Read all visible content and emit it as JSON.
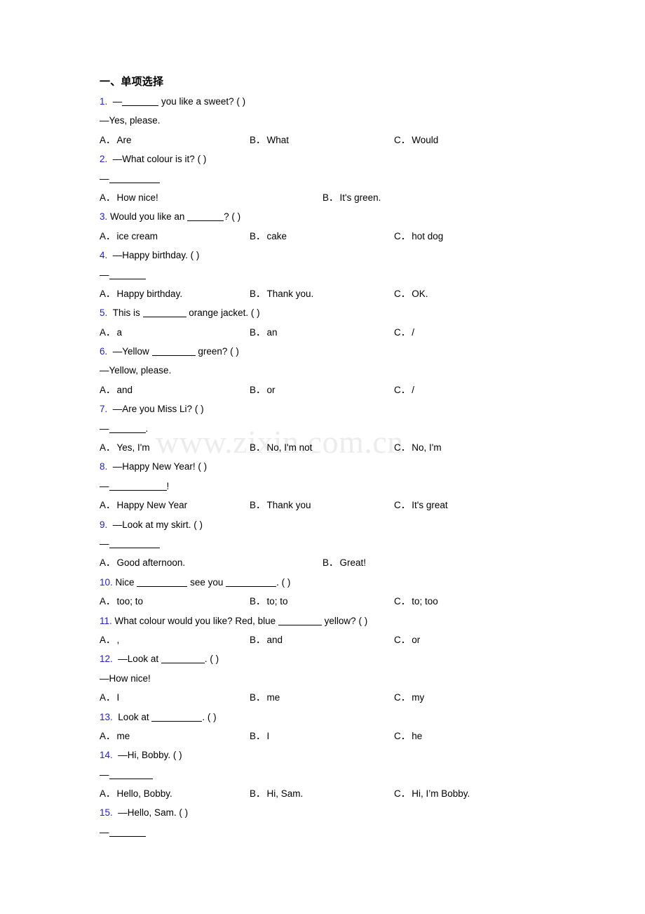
{
  "document": {
    "heading": "一、单项选择",
    "watermark": "www.zixin.com.cn",
    "accent_color": "#2020cc",
    "text_color": "#000000",
    "watermark_color": "#ececec",
    "background_color": "#ffffff"
  },
  "questions": [
    {
      "number": "1.",
      "stem_prefix": "—",
      "stem_suffix": " you like a sweet? (   )",
      "reply": "—Yes, please.",
      "options": [
        {
          "label": "A．",
          "text": "Are"
        },
        {
          "label": "B．",
          "text": "What"
        },
        {
          "label": "C．",
          "text": "Would"
        }
      ]
    },
    {
      "number": "2.",
      "stem_prefix": "—What colour is it? (   )",
      "stem_suffix": "",
      "reply": "—",
      "options": [
        {
          "label": "A．",
          "text": "How nice!"
        },
        {
          "label": "B．",
          "text": "It's green."
        }
      ]
    },
    {
      "number": "3.",
      "stem_prefix": "Would you like an ",
      "stem_suffix": "? (   )",
      "reply": "",
      "options": [
        {
          "label": "A．",
          "text": "ice cream"
        },
        {
          "label": "B．",
          "text": "cake"
        },
        {
          "label": "C．",
          "text": "hot dog"
        }
      ]
    },
    {
      "number": "4.",
      "stem_prefix": "—Happy birthday. (   )",
      "stem_suffix": "",
      "reply": "—",
      "options": [
        {
          "label": "A．",
          "text": "Happy birthday."
        },
        {
          "label": "B．",
          "text": "Thank you."
        },
        {
          "label": "C．",
          "text": "OK."
        }
      ]
    },
    {
      "number": "5.",
      "stem_prefix": "This is ",
      "stem_suffix": " orange jacket. (   )",
      "reply": "",
      "options": [
        {
          "label": "A．",
          "text": "a"
        },
        {
          "label": "B．",
          "text": "an"
        },
        {
          "label": "C．",
          "text": "/"
        }
      ]
    },
    {
      "number": "6.",
      "stem_prefix": "—Yellow ",
      "stem_suffix": " green? (   )",
      "reply": "—Yellow, please.",
      "options": [
        {
          "label": "A．",
          "text": "and"
        },
        {
          "label": "B．",
          "text": "or"
        },
        {
          "label": "C．",
          "text": "/"
        }
      ]
    },
    {
      "number": "7.",
      "stem_prefix": "—Are you Miss Li? (   )",
      "stem_suffix": "",
      "reply": "—",
      "options": [
        {
          "label": "A．",
          "text": "Yes, I'm"
        },
        {
          "label": "B．",
          "text": "No, I'm not"
        },
        {
          "label": "C．",
          "text": "No, I'm"
        }
      ]
    },
    {
      "number": "8.",
      "stem_prefix": "—Happy New Year! (   )",
      "stem_suffix": "",
      "reply": "—",
      "options": [
        {
          "label": "A．",
          "text": "Happy New Year"
        },
        {
          "label": "B．",
          "text": "Thank you"
        },
        {
          "label": "C．",
          "text": "It's great"
        }
      ]
    },
    {
      "number": "9.",
      "stem_prefix": "—Look at my skirt. (   )",
      "stem_suffix": "",
      "reply": "—",
      "options": [
        {
          "label": "A．",
          "text": "Good afternoon."
        },
        {
          "label": "B．",
          "text": "Great!"
        }
      ]
    },
    {
      "number": "10.",
      "stem_prefix": "Nice ",
      "stem_mid": " see you ",
      "stem_suffix": ". (   )",
      "reply": "",
      "options": [
        {
          "label": "A．",
          "text": "too; to"
        },
        {
          "label": "B．",
          "text": "to; to"
        },
        {
          "label": "C．",
          "text": "to; too"
        }
      ]
    },
    {
      "number": "11.",
      "stem_prefix": "What colour would you like? Red, blue ",
      "stem_suffix": " yellow? ( )",
      "reply": "",
      "options": [
        {
          "label": "A．",
          "text": ","
        },
        {
          "label": "B．",
          "text": "and"
        },
        {
          "label": "C．",
          "text": "or"
        }
      ]
    },
    {
      "number": "12.",
      "stem_prefix": "—Look at ",
      "stem_suffix": ". ( )",
      "reply": "—How nice!",
      "options": [
        {
          "label": "A．",
          "text": "I"
        },
        {
          "label": "B．",
          "text": "me"
        },
        {
          "label": "C．",
          "text": "my"
        }
      ]
    },
    {
      "number": "13.",
      "stem_prefix": "Look at ",
      "stem_suffix": ". (    )",
      "reply": "",
      "options": [
        {
          "label": "A．",
          "text": "me"
        },
        {
          "label": "B．",
          "text": "I"
        },
        {
          "label": "C．",
          "text": "he"
        }
      ]
    },
    {
      "number": "14.",
      "stem_prefix": "—Hi, Bobby. ( )",
      "stem_suffix": "",
      "reply": "—",
      "options": [
        {
          "label": "A．",
          "text": "Hello, Bobby."
        },
        {
          "label": "B．",
          "text": "Hi, Sam."
        },
        {
          "label": "C．",
          "text": "Hi, I’m Bobby."
        }
      ]
    },
    {
      "number": "15.",
      "stem_prefix": "—Hello, Sam. (   )",
      "stem_suffix": "",
      "reply": "—",
      "options": []
    }
  ]
}
